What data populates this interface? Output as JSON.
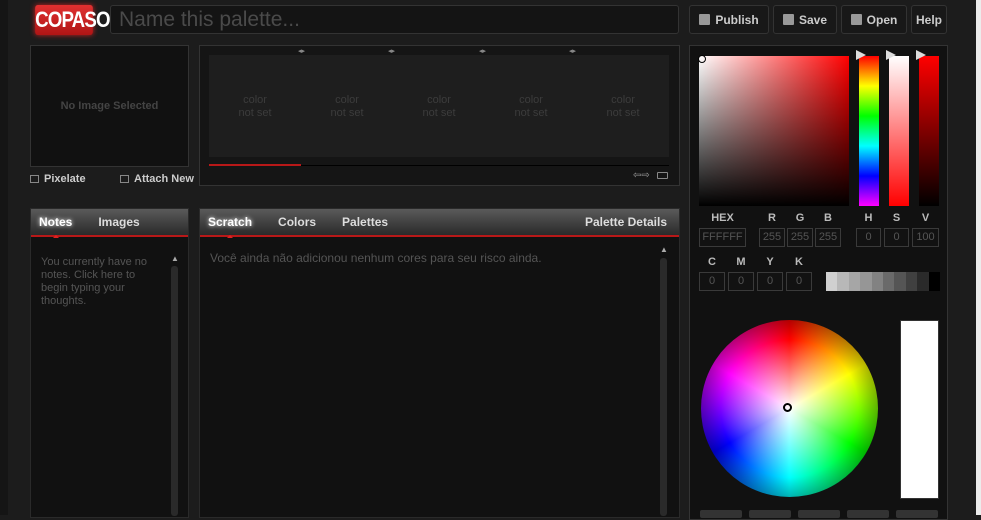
{
  "header": {
    "logo": "COPASO",
    "name_placeholder": "Name this palette...",
    "buttons": {
      "publish": "Publish",
      "save": "Save",
      "open": "Open",
      "help": "Help"
    }
  },
  "image": {
    "empty_text": "No Image Selected",
    "pixelate": "Pixelate",
    "attach_new": "Attach New"
  },
  "palette": {
    "swatches": [
      {
        "l1": "color",
        "l2": "not set"
      },
      {
        "l1": "color",
        "l2": "not set"
      },
      {
        "l1": "color",
        "l2": "not set"
      },
      {
        "l1": "color",
        "l2": "not set"
      },
      {
        "l1": "color",
        "l2": "not set"
      }
    ]
  },
  "notes": {
    "tabs": [
      "Notes",
      "Images"
    ],
    "active": "Notes",
    "empty_text": "You currently have no notes. Click here to begin typing your thoughts."
  },
  "scratch": {
    "tabs": [
      "Scratch",
      "Colors",
      "Palettes"
    ],
    "active": "Scratch",
    "details": "Palette Details",
    "empty_text": "Você ainda não adicionou nenhum cores para seu risco ainda."
  },
  "picker": {
    "hue_color": "#ff0000",
    "labels": {
      "hex": "HEX",
      "r": "R",
      "g": "G",
      "b": "B",
      "h": "H",
      "s": "S",
      "v": "V",
      "c": "C",
      "m": "M",
      "y": "Y",
      "k": "K"
    },
    "values": {
      "hex": "FFFFFF",
      "r": "255",
      "g": "255",
      "b": "255",
      "h": "0",
      "s": "0",
      "v": "100",
      "c": "0",
      "m": "0",
      "y": "0",
      "k": "0"
    },
    "grays": [
      "#d0d0d0",
      "#b8b8b8",
      "#a6a6a6",
      "#969696",
      "#828282",
      "#6a6a6a",
      "#555555",
      "#404040",
      "#2a2a2a",
      "#000000"
    ],
    "preview_color": "#ffffff"
  }
}
